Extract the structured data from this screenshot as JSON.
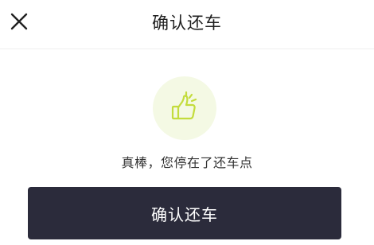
{
  "header": {
    "title": "确认还车",
    "close_icon": "close-icon"
  },
  "status": {
    "icon": "thumbs-up-icon",
    "icon_color": "#c3dc3c",
    "icon_bg": "#f4f9e4",
    "message": "真棒，您停在了还车点"
  },
  "actions": {
    "confirm_label": "确认还车",
    "confirm_bg": "#2b2b3b"
  }
}
